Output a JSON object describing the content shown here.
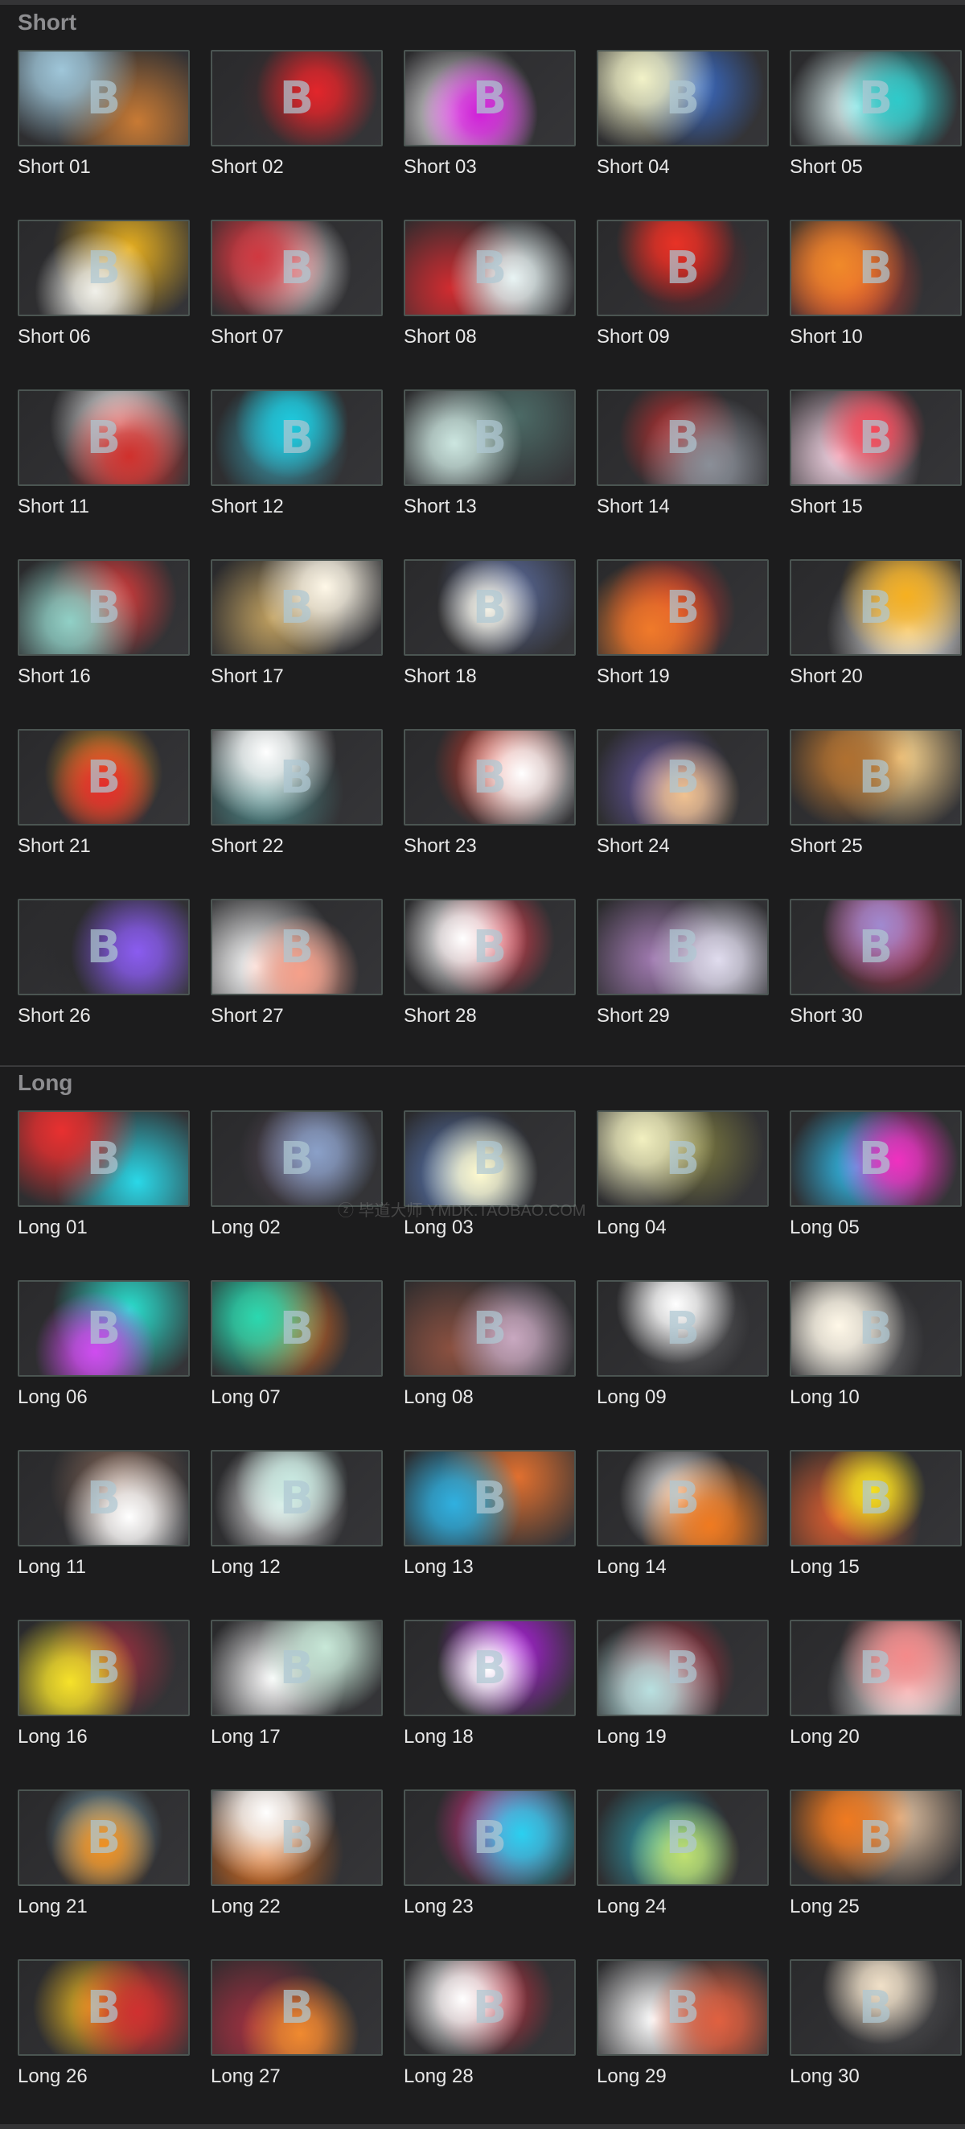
{
  "sections": [
    {
      "title": "Short",
      "items": [
        {
          "label": "Short 01",
          "c1": "#9fc6d9",
          "c2": "#c87a34",
          "glyph": "B"
        },
        {
          "label": "Short 02",
          "c1": "#e2262b",
          "c2": "#4a2a2d",
          "glyph": "B"
        },
        {
          "label": "Short 03",
          "c1": "#d01fd8",
          "c2": "#ffffff",
          "glyph": "B"
        },
        {
          "label": "Short 04",
          "c1": "#f2f2c8",
          "c2": "#3a6cc8",
          "glyph": "B"
        },
        {
          "label": "Short 05",
          "c1": "#2ecaca",
          "c2": "#e8ffff",
          "glyph": "B"
        },
        {
          "label": "Short 06",
          "c1": "#f0f0ea",
          "c2": "#e8b020",
          "glyph": "B"
        },
        {
          "label": "Short 07",
          "c1": "#d03840",
          "c2": "#ffffff",
          "glyph": "B"
        },
        {
          "label": "Short 08",
          "c1": "#e8f4f4",
          "c2": "#d02c30",
          "glyph": "B"
        },
        {
          "label": "Short 09",
          "c1": "#e83226",
          "c2": "#7a1d22",
          "glyph": "B"
        },
        {
          "label": "Short 10",
          "c1": "#f08a2a",
          "c2": "#e84030",
          "glyph": "B"
        },
        {
          "label": "Short 11",
          "c1": "#d0302c",
          "c2": "#ffffff",
          "glyph": "B"
        },
        {
          "label": "Short 12",
          "c1": "#1ec8dc",
          "c2": "#38a0b4",
          "glyph": "B"
        },
        {
          "label": "Short 13",
          "c1": "#cce6e0",
          "c2": "#4c6a66",
          "glyph": "B"
        },
        {
          "label": "Short 14",
          "c1": "#8a8f98",
          "c2": "#c83030",
          "glyph": "B"
        },
        {
          "label": "Short 15",
          "c1": "#f44a5a",
          "c2": "#f6d6e6",
          "glyph": "B"
        },
        {
          "label": "Short 16",
          "c1": "#90d0c6",
          "c2": "#e83c3c",
          "glyph": "B"
        },
        {
          "label": "Short 17",
          "c1": "#fff8e8",
          "c2": "#c0a060",
          "glyph": "B"
        },
        {
          "label": "Short 18",
          "c1": "#f4f2e6",
          "c2": "#5a6a9a",
          "glyph": "B"
        },
        {
          "label": "Short 19",
          "c1": "#f07a2a",
          "c2": "#d8322a",
          "glyph": "B"
        },
        {
          "label": "Short 20",
          "c1": "#f6b020",
          "c2": "#ffffff",
          "glyph": "B"
        },
        {
          "label": "Short 21",
          "c1": "#e22c2c",
          "c2": "#f6a020",
          "glyph": "B"
        },
        {
          "label": "Short 22",
          "c1": "#ffffff",
          "c2": "#4e8a8a",
          "glyph": "B"
        },
        {
          "label": "Short 23",
          "c1": "#ffffff",
          "c2": "#e03a2a",
          "glyph": "B"
        },
        {
          "label": "Short 24",
          "c1": "#f0c290",
          "c2": "#6a5aa8",
          "glyph": "B"
        },
        {
          "label": "Short 25",
          "c1": "#b07030",
          "c2": "#ffd890",
          "glyph": "B"
        },
        {
          "label": "Short 26",
          "c1": "#8a5cf0",
          "c2": "#2a2a2c",
          "glyph": "B"
        },
        {
          "label": "Short 27",
          "c1": "#f6a08a",
          "c2": "#ffffff",
          "glyph": "B"
        },
        {
          "label": "Short 28",
          "c1": "#ffffff",
          "c2": "#e84050",
          "glyph": "B"
        },
        {
          "label": "Short 29",
          "c1": "#e0dcee",
          "c2": "#a07ab0",
          "glyph": "B"
        },
        {
          "label": "Short 30",
          "c1": "#a08ad0",
          "c2": "#d03050",
          "glyph": "B"
        }
      ]
    },
    {
      "title": "Long",
      "items": [
        {
          "label": "Long 01",
          "c1": "#e83030",
          "c2": "#2ad8e8",
          "glyph": "B"
        },
        {
          "label": "Long 02",
          "c1": "#8aa0c8",
          "c2": "#5a4a5a",
          "glyph": "B"
        },
        {
          "label": "Long 03",
          "c1": "#fffbd0",
          "c2": "#5a7ab8",
          "glyph": "B"
        },
        {
          "label": "Long 04",
          "c1": "#f2f0c0",
          "c2": "#7a7840",
          "glyph": "B"
        },
        {
          "label": "Long 05",
          "c1": "#f030c0",
          "c2": "#30c0f0",
          "glyph": "B"
        },
        {
          "label": "Long 06",
          "c1": "#d04cf0",
          "c2": "#2ae0d0",
          "glyph": "B"
        },
        {
          "label": "Long 07",
          "c1": "#2ad8b0",
          "c2": "#f07020",
          "glyph": "B"
        },
        {
          "label": "Long 08",
          "c1": "#c8a8c0",
          "c2": "#8a5040",
          "glyph": "B"
        },
        {
          "label": "Long 09",
          "c1": "#ffffff",
          "c2": "#6a6a6c",
          "glyph": "B"
        },
        {
          "label": "Long 10",
          "c1": "#fff8e8",
          "c2": "#8a8a8c",
          "glyph": "B"
        },
        {
          "label": "Long 11",
          "c1": "#ffffff",
          "c2": "#8a6a5a",
          "glyph": "B"
        },
        {
          "label": "Long 12",
          "c1": "#c8e8e0",
          "c2": "#ffffff",
          "glyph": "B"
        },
        {
          "label": "Long 13",
          "c1": "#30b0e0",
          "c2": "#e07030",
          "glyph": "B"
        },
        {
          "label": "Long 14",
          "c1": "#f07a20",
          "c2": "#ffffff",
          "glyph": "B"
        },
        {
          "label": "Long 15",
          "c1": "#f4e020",
          "c2": "#e06030",
          "glyph": "B"
        },
        {
          "label": "Long 16",
          "c1": "#f6e22a",
          "c2": "#a03040",
          "glyph": "B"
        },
        {
          "label": "Long 17",
          "c1": "#c8e8d8",
          "c2": "#ffffff",
          "glyph": "B"
        },
        {
          "label": "Long 18",
          "c1": "#ffffff",
          "c2": "#b020e0",
          "glyph": "B"
        },
        {
          "label": "Long 19",
          "c1": "#b8e0e0",
          "c2": "#c03040",
          "glyph": "B"
        },
        {
          "label": "Long 20",
          "c1": "#f48a8a",
          "c2": "#ffffff",
          "glyph": "B"
        },
        {
          "label": "Long 21",
          "c1": "#f09020",
          "c2": "#8ab8c8",
          "glyph": "B"
        },
        {
          "label": "Long 22",
          "c1": "#ffffff",
          "c2": "#e07020",
          "glyph": "B"
        },
        {
          "label": "Long 23",
          "c1": "#2ad0f0",
          "c2": "#f03090",
          "glyph": "B"
        },
        {
          "label": "Long 24",
          "c1": "#c0e070",
          "c2": "#30a0b0",
          "glyph": "B"
        },
        {
          "label": "Long 25",
          "c1": "#f07a20",
          "c2": "#e0c0a0",
          "glyph": "B"
        },
        {
          "label": "Long 26",
          "c1": "#d03030",
          "c2": "#f6c020",
          "glyph": "B"
        },
        {
          "label": "Long 27",
          "c1": "#f08a30",
          "c2": "#a03040",
          "glyph": "B"
        },
        {
          "label": "Long 28",
          "c1": "#ffffff",
          "c2": "#c03040",
          "glyph": "B"
        },
        {
          "label": "Long 29",
          "c1": "#e06040",
          "c2": "#ffffff",
          "glyph": "B"
        },
        {
          "label": "Long 30",
          "c1": "#f0e0c8",
          "c2": "#5a5a5c",
          "glyph": "B"
        }
      ]
    }
  ],
  "watermark": "ⓩ 毕道大师 YMDK.TAOBAO.COM"
}
